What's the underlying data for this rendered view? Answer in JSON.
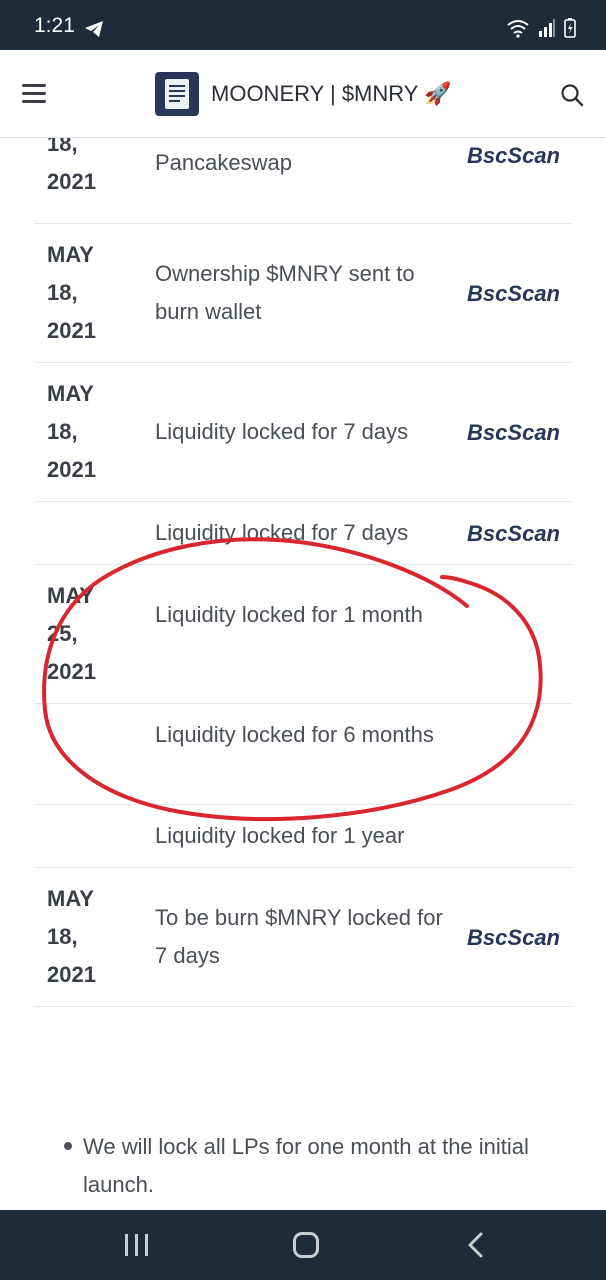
{
  "status_bar": {
    "time": "1:21"
  },
  "header": {
    "title": "MOONERY | $MNRY 🚀"
  },
  "table": {
    "rows": [
      {
        "date": "18,\n2021",
        "event": "Adding Liquidity to\nPancakeswap",
        "link": "BscScan"
      },
      {
        "date": "MAY\n18,\n2021",
        "event": "Ownership $MNRY sent to burn wallet",
        "link": "BscScan"
      },
      {
        "date": "MAY\n18,\n2021",
        "event": "Liquidity locked for 7 days",
        "link": "BscScan"
      },
      {
        "date": "",
        "event": "Liquidity locked for 7 days",
        "link": "BscScan"
      },
      {
        "date": "MAY\n25,\n2021",
        "event": "Liquidity locked for 1 month",
        "link": ""
      },
      {
        "date": "",
        "event": "Liquidity locked for 6 months",
        "link": ""
      },
      {
        "date": "",
        "event": "Liquidity locked for 1 year",
        "link": ""
      },
      {
        "date": "MAY\n18,\n2021",
        "event": "To be burn $MNRY locked for 7 days",
        "link": "BscScan"
      }
    ]
  },
  "bullets": [
    "We will lock all LPs for one month at the initial launch."
  ],
  "annotation": {
    "color": "#d9262e"
  }
}
